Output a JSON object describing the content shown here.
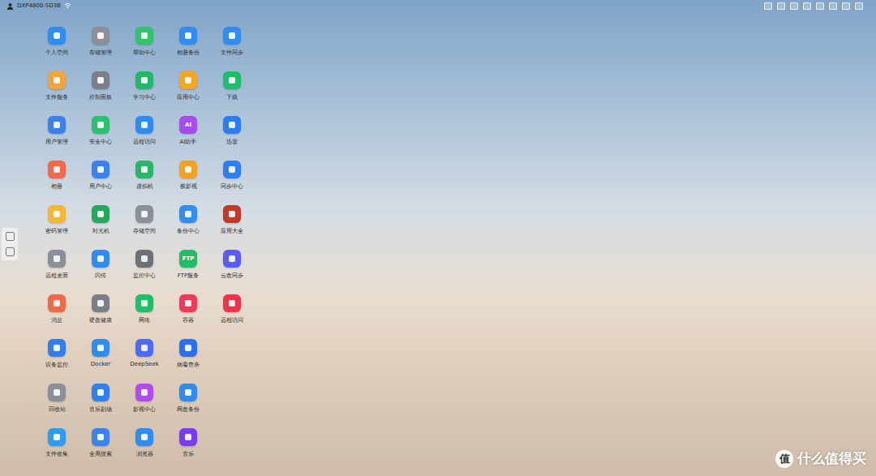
{
  "topbar": {
    "device": "DXP4800-5D3B"
  },
  "desktop": {
    "rows": [
      {
        "apps": [
          {
            "label": "个人空间",
            "color": "#2f8cf0"
          },
          {
            "label": "存储管理",
            "color": "#8a8f99"
          },
          {
            "label": "帮助中心",
            "color": "#2fc36b"
          },
          {
            "label": "相册备份",
            "color": "#2f8cf0"
          },
          {
            "label": "文件同步",
            "color": "#2f8cf0"
          }
        ]
      },
      {
        "apps": [
          {
            "label": "文件服务",
            "color": "#f0a43a"
          },
          {
            "label": "控制面板",
            "color": "#7a7f88"
          },
          {
            "label": "学习中心",
            "color": "#22b86a"
          },
          {
            "label": "应用中心",
            "color": "#f5a623"
          },
          {
            "label": "下载",
            "color": "#1fbf6a"
          }
        ]
      },
      {
        "apps": [
          {
            "label": "用户管理",
            "color": "#3b7ff0"
          },
          {
            "label": "安全中心",
            "color": "#2cc16e"
          },
          {
            "label": "远程访问",
            "color": "#2f8cf0"
          },
          {
            "label": "AI助手",
            "color": "#a64cf0",
            "icon_text": "AI"
          },
          {
            "label": "迅雷",
            "color": "#2a7df5"
          }
        ]
      },
      {
        "apps": [
          {
            "label": "相册",
            "color": "#f06a4a"
          },
          {
            "label": "用户中心",
            "color": "#3b82f0"
          },
          {
            "label": "虚拟机",
            "color": "#25b866"
          },
          {
            "label": "极影视",
            "color": "#f5a020"
          },
          {
            "label": "同步中心",
            "color": "#2f7ff0"
          }
        ]
      },
      {
        "apps": [
          {
            "label": "密码管理",
            "color": "#f5b535"
          },
          {
            "label": "时光机",
            "color": "#25a95c"
          },
          {
            "label": "存储空间",
            "color": "#8a8f99"
          },
          {
            "label": "备份中心",
            "color": "#2f8cf0"
          },
          {
            "label": "应用大全",
            "color": "#c0392b"
          }
        ]
      },
      {
        "apps": [
          {
            "label": "远程桌面",
            "color": "#8a8f99"
          },
          {
            "label": "闪传",
            "color": "#2f8cf0"
          },
          {
            "label": "监控中心",
            "color": "#6d727a"
          },
          {
            "label": "FTP服务",
            "color": "#1fbf6a",
            "icon_text": "FTP"
          },
          {
            "label": "云盘同步",
            "color": "#5a5ef0"
          }
        ]
      },
      {
        "apps": [
          {
            "label": "消息",
            "color": "#f06a4a"
          },
          {
            "label": "硬盘健康",
            "color": "#7a7f88"
          },
          {
            "label": "网络",
            "color": "#1fbf6a"
          },
          {
            "label": "容器",
            "color": "#f03a5a"
          },
          {
            "label": "远程访问",
            "color": "#f0354a"
          }
        ]
      },
      {
        "apps": [
          {
            "label": "设备监控",
            "color": "#2f7ff0"
          },
          {
            "label": "Docker",
            "color": "#2f8cf0"
          },
          {
            "label": "DeepSeek",
            "color": "#4d6bfe"
          },
          {
            "label": "病毒查杀",
            "color": "#2a6ff0"
          }
        ]
      },
      {
        "apps": [
          {
            "label": "回收站",
            "color": "#8a8f99"
          },
          {
            "label": "音乐剧场",
            "color": "#2f7ff0"
          },
          {
            "label": "影视中心",
            "color": "#b04cf0"
          },
          {
            "label": "网盘备份",
            "color": "#2f8cf0"
          }
        ]
      },
      {
        "apps": [
          {
            "label": "文件收集",
            "color": "#2f9cf0"
          },
          {
            "label": "全局搜索",
            "color": "#3b82f0"
          },
          {
            "label": "浏览器",
            "color": "#2f8cf0"
          },
          {
            "label": "音乐",
            "color": "#7a3cf0"
          }
        ]
      }
    ]
  },
  "watermark": {
    "mark": "值",
    "text": "什么值得买"
  }
}
